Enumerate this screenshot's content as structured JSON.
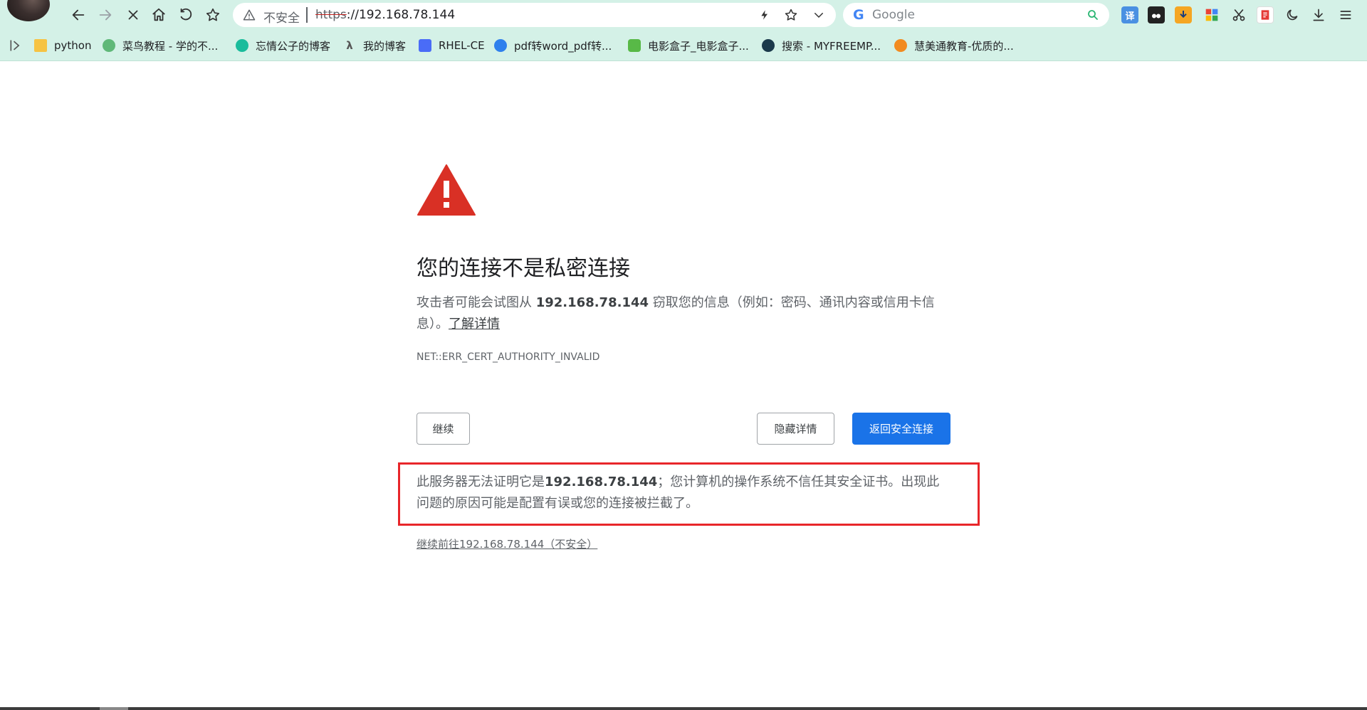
{
  "toolbar": {
    "omnibox": {
      "security_label": "不安全",
      "url_scheme": "https",
      "url_rest": "://192.168.78.144"
    },
    "search": {
      "engine_logo": "G",
      "placeholder": "Google"
    },
    "extensions": [
      {
        "icon": "translate-icon",
        "label": "译",
        "color": "#4a90e2"
      },
      {
        "icon": "tampermonkey-icon",
        "label": "",
        "color": "#222222"
      },
      {
        "icon": "download-helper-icon",
        "label": "",
        "color": "#f5a623"
      },
      {
        "icon": "apps-grid-icon",
        "label": "",
        "color": "#e94235"
      },
      {
        "icon": "scissors-icon",
        "label": "",
        "color": "#333333"
      },
      {
        "icon": "pdf-icon",
        "label": "",
        "color": "#e53935"
      },
      {
        "icon": "dark-mode-icon",
        "label": "",
        "color": "#333333"
      },
      {
        "icon": "download-icon",
        "label": "",
        "color": "#333333"
      },
      {
        "icon": "menu-icon",
        "label": "",
        "color": "#333333"
      }
    ]
  },
  "bookmarks": [
    {
      "label": "python",
      "icon": "folder-icon",
      "color": "#f6c343"
    },
    {
      "label": "菜鸟教程 - 学的不...",
      "icon": "runoob-icon",
      "color": "#5fb878"
    },
    {
      "label": "忘情公子的博客",
      "icon": "blog-icon",
      "color": "#1abc9c"
    },
    {
      "label": "我的博客",
      "icon": "lambda-icon",
      "color": "#555555"
    },
    {
      "label": "RHEL-CE",
      "icon": "doc-icon",
      "color": "#4a6cf7"
    },
    {
      "label": "pdf转word_pdf转...",
      "icon": "pdf-convert-icon",
      "color": "#2f80ed"
    },
    {
      "label": "电影盒子_电影盒子...",
      "icon": "movie-box-icon",
      "color": "#58b947"
    },
    {
      "label": "搜索 - MYFREEMP...",
      "icon": "music-search-icon",
      "color": "#1b3a4b"
    },
    {
      "label": "慧美通教育-优质的...",
      "icon": "edu-icon",
      "color": "#f28b20"
    }
  ],
  "interstitial": {
    "title": "您的连接不是私密连接",
    "message_prefix": "攻击者可能会试图从 ",
    "host": "192.168.78.144",
    "message_suffix": " 窃取您的信息（例如：密码、通讯内容或信用卡信息）。",
    "learn_more": "了解详情",
    "error_code": "NET::ERR_CERT_AUTHORITY_INVALID",
    "buttons": {
      "continue": "继续",
      "hide_details": "隐藏详情",
      "back_to_safety": "返回安全连接"
    },
    "details_prefix": "此服务器无法证明它是",
    "details_host": "192.168.78.144",
    "details_suffix": "；您计算机的操作系统不信任其安全证书。出现此问题的原因可能是配置有误或您的连接被拦截了。",
    "proceed_link": "继续前往192.168.78.144（不安全）"
  },
  "colors": {
    "toolbar_bg": "#d4f1e7",
    "primary": "#1a73e8",
    "danger": "#d93025",
    "highlight_box": "#e8262a"
  }
}
